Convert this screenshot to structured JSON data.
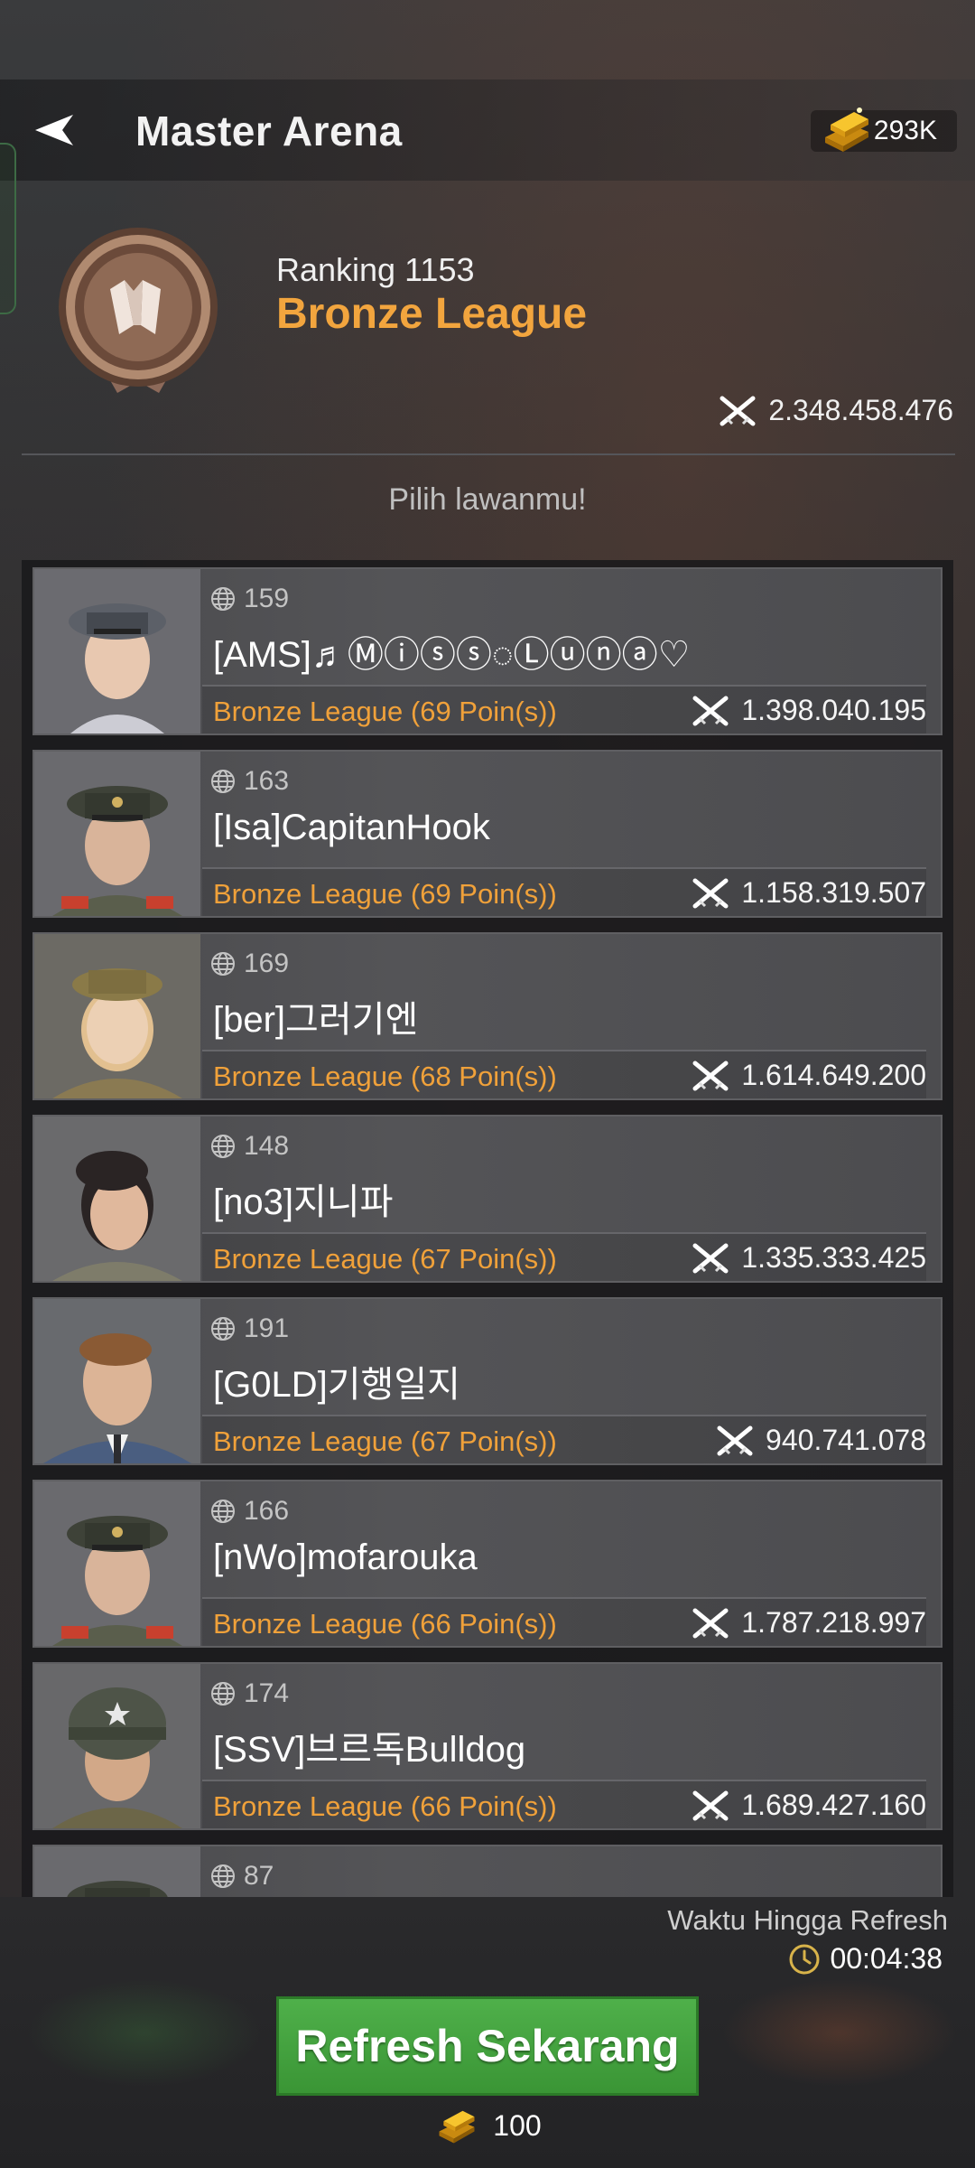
{
  "header": {
    "title": "Master Arena",
    "gold_amount": "293K"
  },
  "league": {
    "ranking": "Ranking 1153",
    "name": "Bronze League",
    "total_power": "2.348.458.476"
  },
  "subtitle": "Pilih lawanmu!",
  "opponents": [
    {
      "server": "159",
      "name": "[AMS]♬Ⓜⓘⓢⓢ◌Ⓛⓤⓝⓐ♡",
      "league": "Bronze League (69 Poin(s))",
      "power": "1.398.040.195",
      "portrait": "female-officer-peaked-cap-icon"
    },
    {
      "server": "163",
      "name": "[Isa]CapitanHook",
      "league": "Bronze League (69 Poin(s))",
      "power": "1.158.319.507",
      "portrait": "male-general-peaked-cap-icon"
    },
    {
      "server": "169",
      "name": "[ber]그러기엔",
      "league": "Bronze League (68 Poin(s))",
      "power": "1.614.649.200",
      "portrait": "female-officer-khaki-cap-icon"
    },
    {
      "server": "148",
      "name": "[no3]지니파",
      "league": "Bronze League (67 Poin(s))",
      "power": "1.335.333.425",
      "portrait": "female-officer-dark-hair-icon"
    },
    {
      "server": "191",
      "name": "[G0LD]기행일지",
      "league": "Bronze League (67 Poin(s))",
      "power": "940.741.078",
      "portrait": "male-officer-blue-uniform-icon"
    },
    {
      "server": "166",
      "name": "[nWo]mofarouka",
      "league": "Bronze League (66 Poin(s))",
      "power": "1.787.218.997",
      "portrait": "male-general-peaked-cap-icon"
    },
    {
      "server": "174",
      "name": "[SSV]브르독Bulldog",
      "league": "Bronze League (66 Poin(s))",
      "power": "1.689.427.160",
      "portrait": "male-soldier-helmet-icon"
    },
    {
      "server": "87",
      "name": "",
      "league": "",
      "power": "",
      "portrait": "male-general-peaked-cap-icon"
    }
  ],
  "refresh": {
    "label": "Waktu Hingga Refresh",
    "timer": "00:04:38",
    "button": "Refresh Sekarang",
    "cost": "100"
  },
  "colors": {
    "accent_orange": "#f2a53e",
    "button_green": "#3a9535"
  }
}
